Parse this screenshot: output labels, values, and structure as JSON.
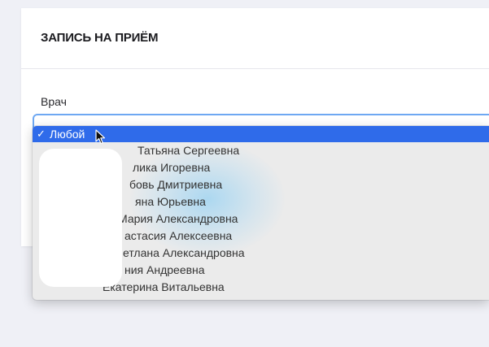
{
  "form": {
    "title": "ЗАПИСЬ НА ПРИЁМ",
    "doctor_label": "Врач"
  },
  "dropdown": {
    "selected_marker": "✓",
    "options": [
      "Любой",
      "Татьяна Сергеевна",
      "лика Игоревна",
      "бовь Дмитриевна",
      "яна Юрьевна",
      "Мария Александровна",
      "астасия Алексеевна",
      "етлана Александровна",
      "ния Андреевна",
      "Екатерина Витальевна"
    ]
  },
  "colors": {
    "selection": "#2f6bea",
    "focus_ring": "#6ea8f2",
    "page_background": "#eff0f6"
  },
  "icons": {
    "cursor": "arrow-cursor-icon",
    "check": "checkmark-icon"
  }
}
